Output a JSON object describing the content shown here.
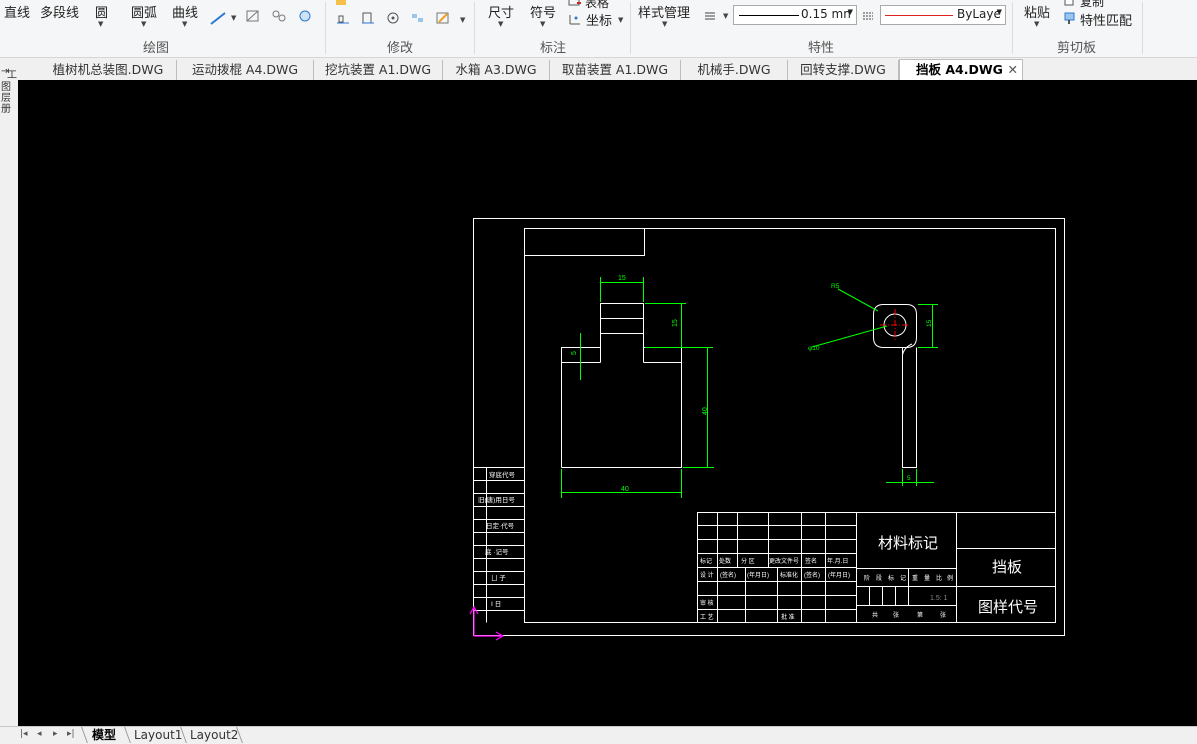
{
  "ribbon": {
    "draw_group": {
      "line": "直线",
      "polyline": "多段线",
      "circle": "圆",
      "arc": "圆弧",
      "curve": "曲线",
      "label": "绘图"
    },
    "modify_group": {
      "label": "修改"
    },
    "annotate_group": {
      "dimension": "尺寸",
      "symbol": "符号",
      "table": "表格",
      "coordinate": "坐标",
      "label": "标注"
    },
    "properties_group": {
      "style_manager": "样式管理",
      "lineweight": "0.15 mn",
      "linetype": "ByLaye",
      "label": "特性"
    },
    "clipboard_group": {
      "paste": "粘贴",
      "copy": "复制",
      "match_properties": "特性匹配",
      "label": "剪切板"
    }
  },
  "doc_tabs": [
    "植树机总装图.DWG",
    "运动拨棍 A4.DWG",
    "挖坑装置 A1.DWG",
    "水箱 A3.DWG",
    "取苗装置 A1.DWG",
    "机械手.DWG",
    "回转支撑.DWG",
    "挡板 A4.DWG"
  ],
  "active_tab": "挡板 A4.DWG",
  "left_strip": [
    "工",
    "图",
    "层",
    "册"
  ],
  "layout_tabs": {
    "model": "模型",
    "layout1": "Layout1",
    "layout2": "Layout2"
  },
  "drawing": {
    "left_side_cells": [
      "穿底代号",
      "旧(唐)用日号",
      "日定·代号",
      "底 ·记号",
      "ㄩ 子",
      "Ⅰ 日"
    ],
    "front_view_dims": {
      "top_width": "15",
      "height_upper": "15",
      "left_small": "5",
      "height_main": "40",
      "bottom_width": "40"
    },
    "side_view_dims": {
      "r_label": "R5",
      "dia_label": "φ10",
      "right_height": "15",
      "bottom_dim": "5"
    },
    "title_block": {
      "material_mark": "材料标记",
      "part_name": "挡板",
      "drawing_code": "图样代号",
      "scale": "1.5: 1",
      "sign_row1": [
        "标记",
        "处数",
        "分 区",
        "更改文件号",
        "签名",
        "年.月.日"
      ],
      "sign_row2": [
        "设 计",
        "(签名)",
        "(年月日)",
        "标准化",
        "(签名)",
        "(年月日)"
      ],
      "review": "审 核",
      "process": "工 艺",
      "approve": "批 准",
      "stage_row": [
        "阶",
        "段",
        "标",
        "记",
        "重",
        "量",
        "比",
        "例"
      ],
      "sheet_row": [
        "共",
        "张",
        "第",
        "张"
      ]
    }
  },
  "colors": {
    "canvas": "#000000",
    "outline": "#ffffff",
    "dimension": "#00ff00",
    "centerline": "#ff0000",
    "ucs": "#ff00ff"
  }
}
